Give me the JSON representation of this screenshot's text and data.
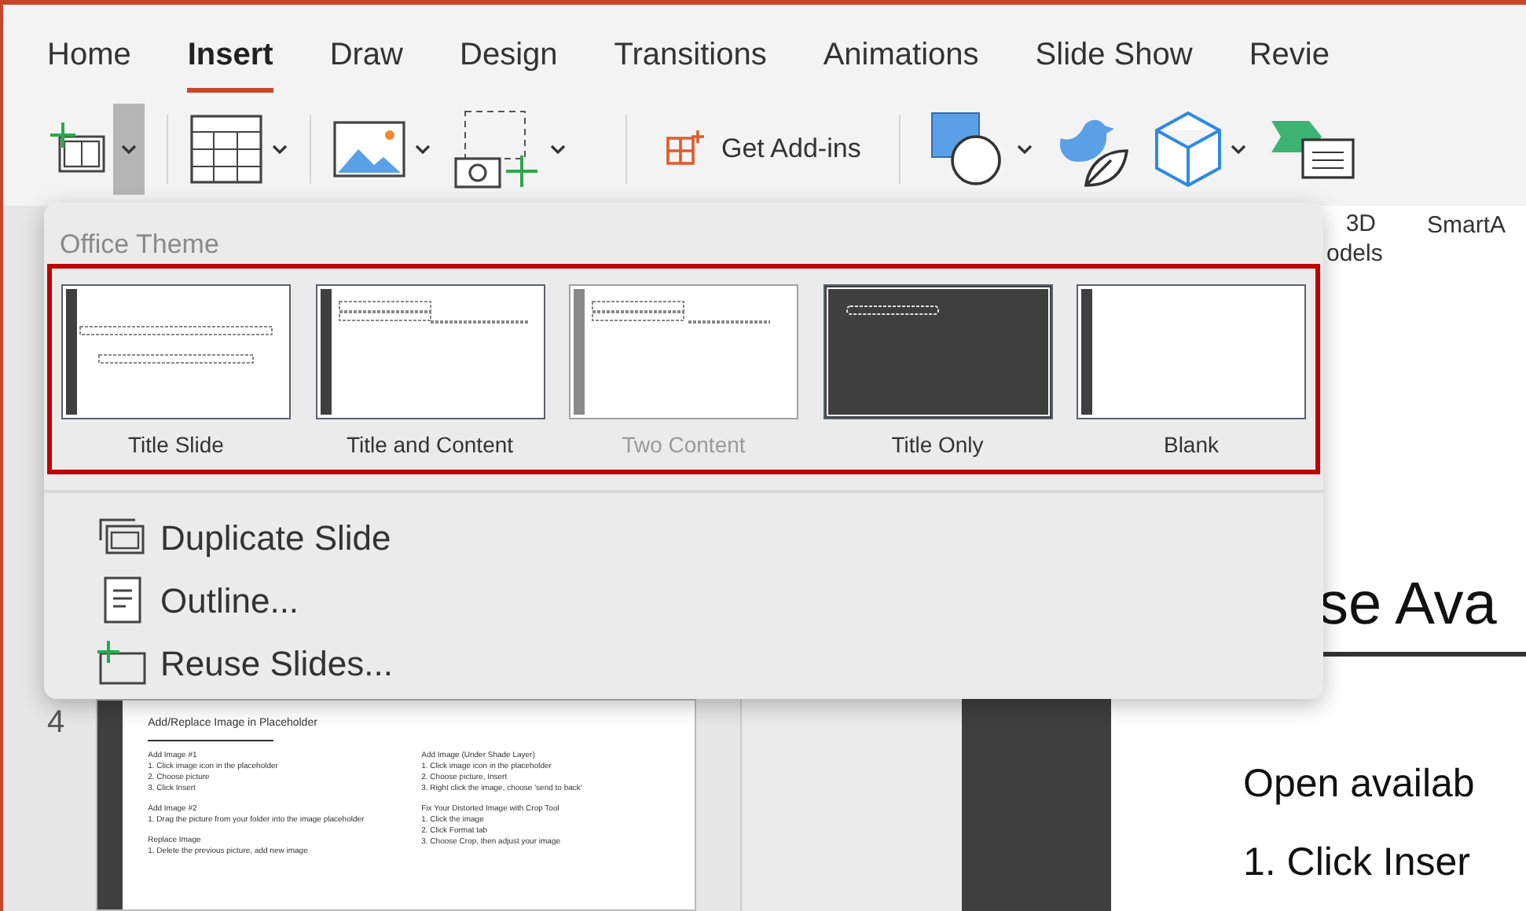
{
  "ribbon_tabs": [
    {
      "label": "Home",
      "selected": false
    },
    {
      "label": "Insert",
      "selected": true
    },
    {
      "label": "Draw",
      "selected": false
    },
    {
      "label": "Design",
      "selected": false
    },
    {
      "label": "Transitions",
      "selected": false
    },
    {
      "label": "Animations",
      "selected": false
    },
    {
      "label": "Slide Show",
      "selected": false
    },
    {
      "label": "Revie",
      "selected": false
    }
  ],
  "toolbar": {
    "add_ins_label": "Get Add-ins",
    "models_label": [
      "3D",
      "odels"
    ],
    "smartart_label": "SmartA"
  },
  "new_slide_menu": {
    "section_title": "Office Theme",
    "layouts": [
      {
        "kind": "title_slide",
        "label": "Title Slide",
        "disabled": false
      },
      {
        "kind": "title_content",
        "label": "Title and Content",
        "disabled": false
      },
      {
        "kind": "two_content",
        "label": "Two Content",
        "disabled": true
      },
      {
        "kind": "title_only",
        "label": "Title Only",
        "disabled": false
      },
      {
        "kind": "blank",
        "label": "Blank",
        "disabled": false
      }
    ],
    "items": [
      {
        "kind": "duplicate",
        "label": "Duplicate Slide"
      },
      {
        "kind": "outline",
        "label": "Outline..."
      },
      {
        "kind": "reuse",
        "label": "Reuse Slides..."
      }
    ]
  },
  "thumbnail_pane": {
    "slide_number": "4",
    "slide_title": "Add/Replace Image in Placeholder",
    "columns": [
      [
        {
          "heading": "Add Image #1",
          "lines": [
            "1. Click image icon in the placeholder",
            "2. Choose picture",
            "3. Click Insert"
          ]
        },
        {
          "heading": "Add Image #2",
          "lines": [
            "1. Drag the picture from your folder into the image placeholder"
          ]
        },
        {
          "heading": "Replace Image",
          "lines": [
            "1. Delete the previous picture, add new image"
          ]
        }
      ],
      [
        {
          "heading": "Add Image (Under Shade Layer)",
          "lines": [
            "1. Click image icon in the placeholder",
            "2. Choose picture, Insert",
            "3. Right click the image, choose 'send to back'"
          ]
        },
        {
          "heading": "Fix Your Distorted Image with Crop Tool",
          "lines": [
            "1. Click the image",
            "2. Click Format tab",
            "3. Choose Crop, then adjust your image"
          ]
        }
      ]
    ]
  },
  "slide": {
    "title": "se Ava",
    "body": [
      "Open availab",
      "1. Click Inser"
    ]
  }
}
